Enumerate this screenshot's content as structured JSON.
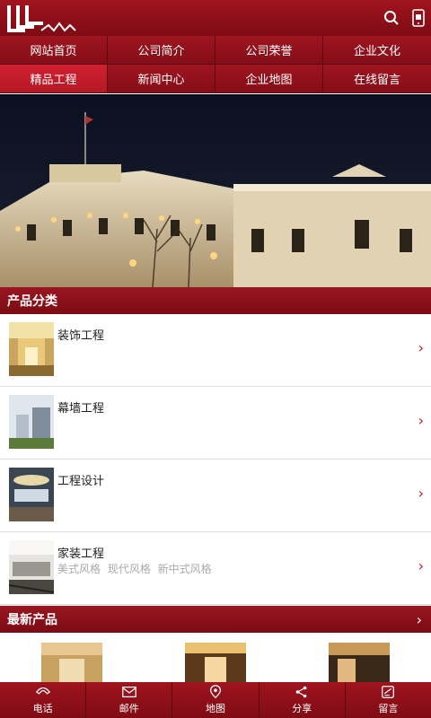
{
  "header": {
    "logo_icon": "company-logo",
    "search_icon": "search-icon",
    "phone_icon": "mobile-icon"
  },
  "nav": {
    "items": [
      {
        "label": "网站首页"
      },
      {
        "label": "公司简介"
      },
      {
        "label": "公司荣誉"
      },
      {
        "label": "企业文化"
      },
      {
        "label": "精品工程"
      },
      {
        "label": "新闻中心"
      },
      {
        "label": "企业地图"
      },
      {
        "label": "在线留言"
      }
    ],
    "active_index": 4
  },
  "hero": {
    "image": "night-building-photo"
  },
  "categories": {
    "title": "产品分类",
    "items": [
      {
        "label": "装饰工程",
        "sub": ""
      },
      {
        "label": "幕墙工程",
        "sub": ""
      },
      {
        "label": "工程设计",
        "sub": ""
      },
      {
        "label": "家装工程",
        "sub": "美式风格 现代风格 新中式风格"
      }
    ]
  },
  "latest": {
    "title": "最新产品",
    "chevron": "›"
  },
  "footer": {
    "items": [
      {
        "label": "电话",
        "icon": "phone-icon"
      },
      {
        "label": "邮件",
        "icon": "mail-icon"
      },
      {
        "label": "地图",
        "icon": "map-pin-icon"
      },
      {
        "label": "分享",
        "icon": "share-icon"
      },
      {
        "label": "留言",
        "icon": "edit-icon"
      }
    ]
  },
  "colors": {
    "brand_red": "#8c0f18",
    "active_red": "#c81c2b",
    "chevron_red": "#c0172a"
  }
}
